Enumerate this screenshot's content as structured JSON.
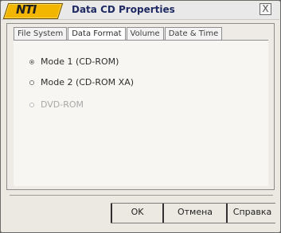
{
  "window": {
    "logo_text": "NTI",
    "title": "Data CD Properties",
    "close_label": "X"
  },
  "tabs": [
    {
      "label": "File System",
      "selected": false
    },
    {
      "label": "Data Format",
      "selected": true
    },
    {
      "label": "Volume",
      "selected": false
    },
    {
      "label": "Date & Time",
      "selected": false
    }
  ],
  "options": [
    {
      "label": "Mode 1 (CD-ROM)",
      "checked": true,
      "enabled": true
    },
    {
      "label": "Mode 2 (CD-ROM XA)",
      "checked": false,
      "enabled": true
    },
    {
      "label": "DVD-ROM",
      "checked": false,
      "enabled": false
    }
  ],
  "buttons": {
    "ok": "OK",
    "cancel": "Отмена",
    "help": "Справка"
  }
}
